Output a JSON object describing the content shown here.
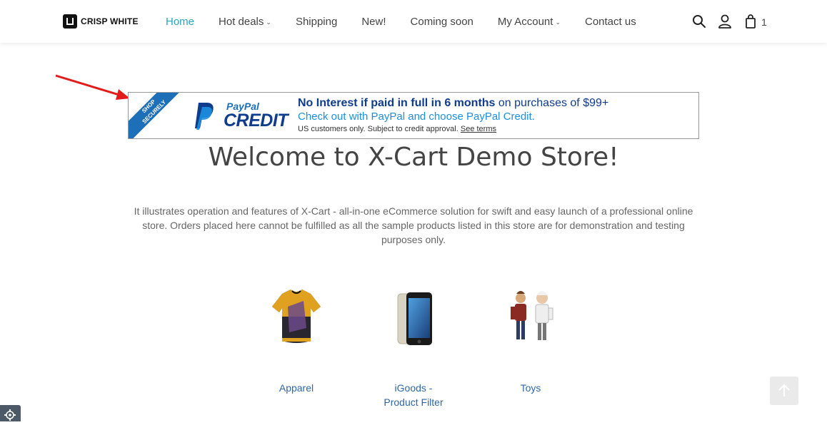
{
  "header": {
    "logo_text": "CRISP WHITE",
    "nav": [
      {
        "label": "Home",
        "active": true,
        "has_dropdown": false
      },
      {
        "label": "Hot deals",
        "active": false,
        "has_dropdown": true
      },
      {
        "label": "Shipping",
        "active": false,
        "has_dropdown": false
      },
      {
        "label": "New!",
        "active": false,
        "has_dropdown": false
      },
      {
        "label": "Coming soon",
        "active": false,
        "has_dropdown": false
      },
      {
        "label": "My Account",
        "active": false,
        "has_dropdown": true
      },
      {
        "label": "Contact us",
        "active": false,
        "has_dropdown": false
      }
    ],
    "icons": [
      "search-icon",
      "user-icon",
      "cart-icon"
    ],
    "cart_count": "1"
  },
  "banner": {
    "ribbon_line1": "SHOP",
    "ribbon_line2": "SECURELY",
    "brand_word1": "PayPal",
    "brand_word2": "CREDIT",
    "line1_bold": "No Interest if paid in full in 6 months",
    "line1_rest": " on purchases of $99+",
    "line2": "Check out with PayPal and choose PayPal Credit.",
    "line3": "US customers only. Subject to credit approval.",
    "line3_link": "See terms"
  },
  "main": {
    "title": "Welcome to X-Cart Demo Store!",
    "intro": "It illustrates operation and features of X-Cart - all-in-one eCommerce solution for swift and easy launch of a professional online store. Orders placed here cannot be fulfilled as all the sample products listed in this store are for demonstration and testing purposes only.",
    "categories": [
      {
        "label": "Apparel"
      },
      {
        "label": "iGoods - Product Filter"
      },
      {
        "label": "Toys"
      }
    ]
  },
  "colors": {
    "accent": "#27a5c7",
    "link": "#2f67a5",
    "paypal_dark": "#0f3c8c",
    "paypal_light": "#1d8fe0",
    "annotation": "#e21b1b"
  }
}
